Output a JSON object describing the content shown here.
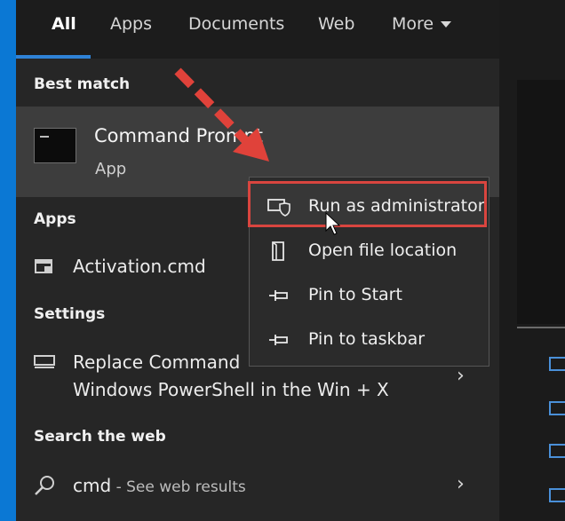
{
  "tabs": [
    {
      "label": "All",
      "active": true
    },
    {
      "label": "Apps"
    },
    {
      "label": "Documents"
    },
    {
      "label": "Web"
    },
    {
      "label": "More"
    }
  ],
  "best_match": {
    "heading": "Best match",
    "title": "Command Prompt",
    "subtitle": "App",
    "icon": "command-prompt-icon"
  },
  "apps": {
    "heading": "Apps",
    "items": [
      {
        "label": "Activation.cmd",
        "icon": "script-file-icon"
      }
    ]
  },
  "settings": {
    "heading": "Settings",
    "items": [
      {
        "line1": "Replace Command",
        "line2": "Windows PowerShell in the Win + X",
        "icon": "monitor-icon"
      }
    ]
  },
  "web": {
    "heading": "Search the web",
    "query": "cmd",
    "suffix": " - See web results",
    "icon": "search-icon"
  },
  "context_menu": {
    "items": [
      {
        "label": "Run as administrator",
        "icon": "shield-monitor-icon",
        "highlighted": true
      },
      {
        "label": "Open file location",
        "icon": "folder-file-icon"
      },
      {
        "label": "Pin to Start",
        "icon": "pin-icon"
      },
      {
        "label": "Pin to taskbar",
        "icon": "pin-icon"
      }
    ]
  },
  "colors": {
    "accent": "#0b78d4",
    "highlight_border": "#d9453f",
    "arrow": "#e0423a",
    "background": "#262626"
  }
}
